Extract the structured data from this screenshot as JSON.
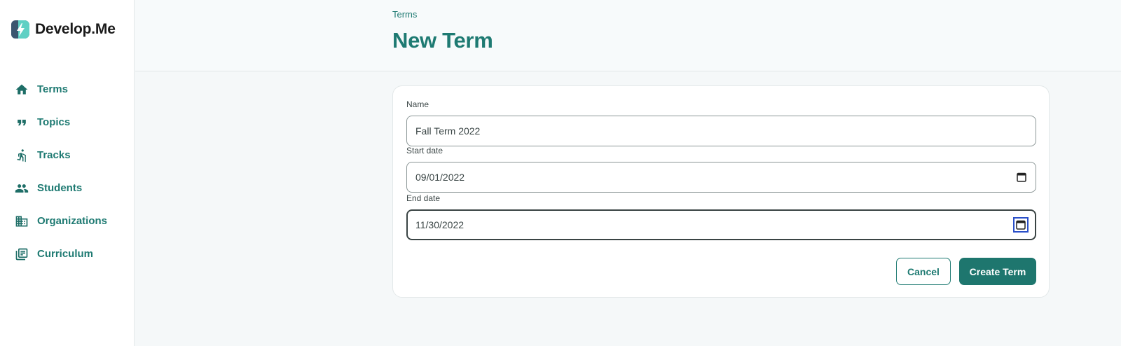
{
  "brand": {
    "name": "Develop.Me",
    "logo_icon": "bolt-logo-icon"
  },
  "sidebar": {
    "items": [
      {
        "label": "Terms",
        "icon": "home-icon"
      },
      {
        "label": "Topics",
        "icon": "quote-icon"
      },
      {
        "label": "Tracks",
        "icon": "hiker-icon"
      },
      {
        "label": "Students",
        "icon": "people-icon"
      },
      {
        "label": "Organizations",
        "icon": "building-icon"
      },
      {
        "label": "Curriculum",
        "icon": "library-books-icon"
      }
    ]
  },
  "header": {
    "breadcrumb": "Terms",
    "title": "New Term"
  },
  "form": {
    "name": {
      "label": "Name",
      "value": "Fall Term 2022"
    },
    "start_date": {
      "label": "Start date",
      "value": "09/01/2022"
    },
    "end_date": {
      "label": "End date",
      "value": "11/30/2022"
    },
    "cancel_label": "Cancel",
    "submit_label": "Create Term"
  },
  "colors": {
    "accent": "#1e7a72",
    "primary_button": "#1e766e",
    "background": "#f5f8f9"
  }
}
